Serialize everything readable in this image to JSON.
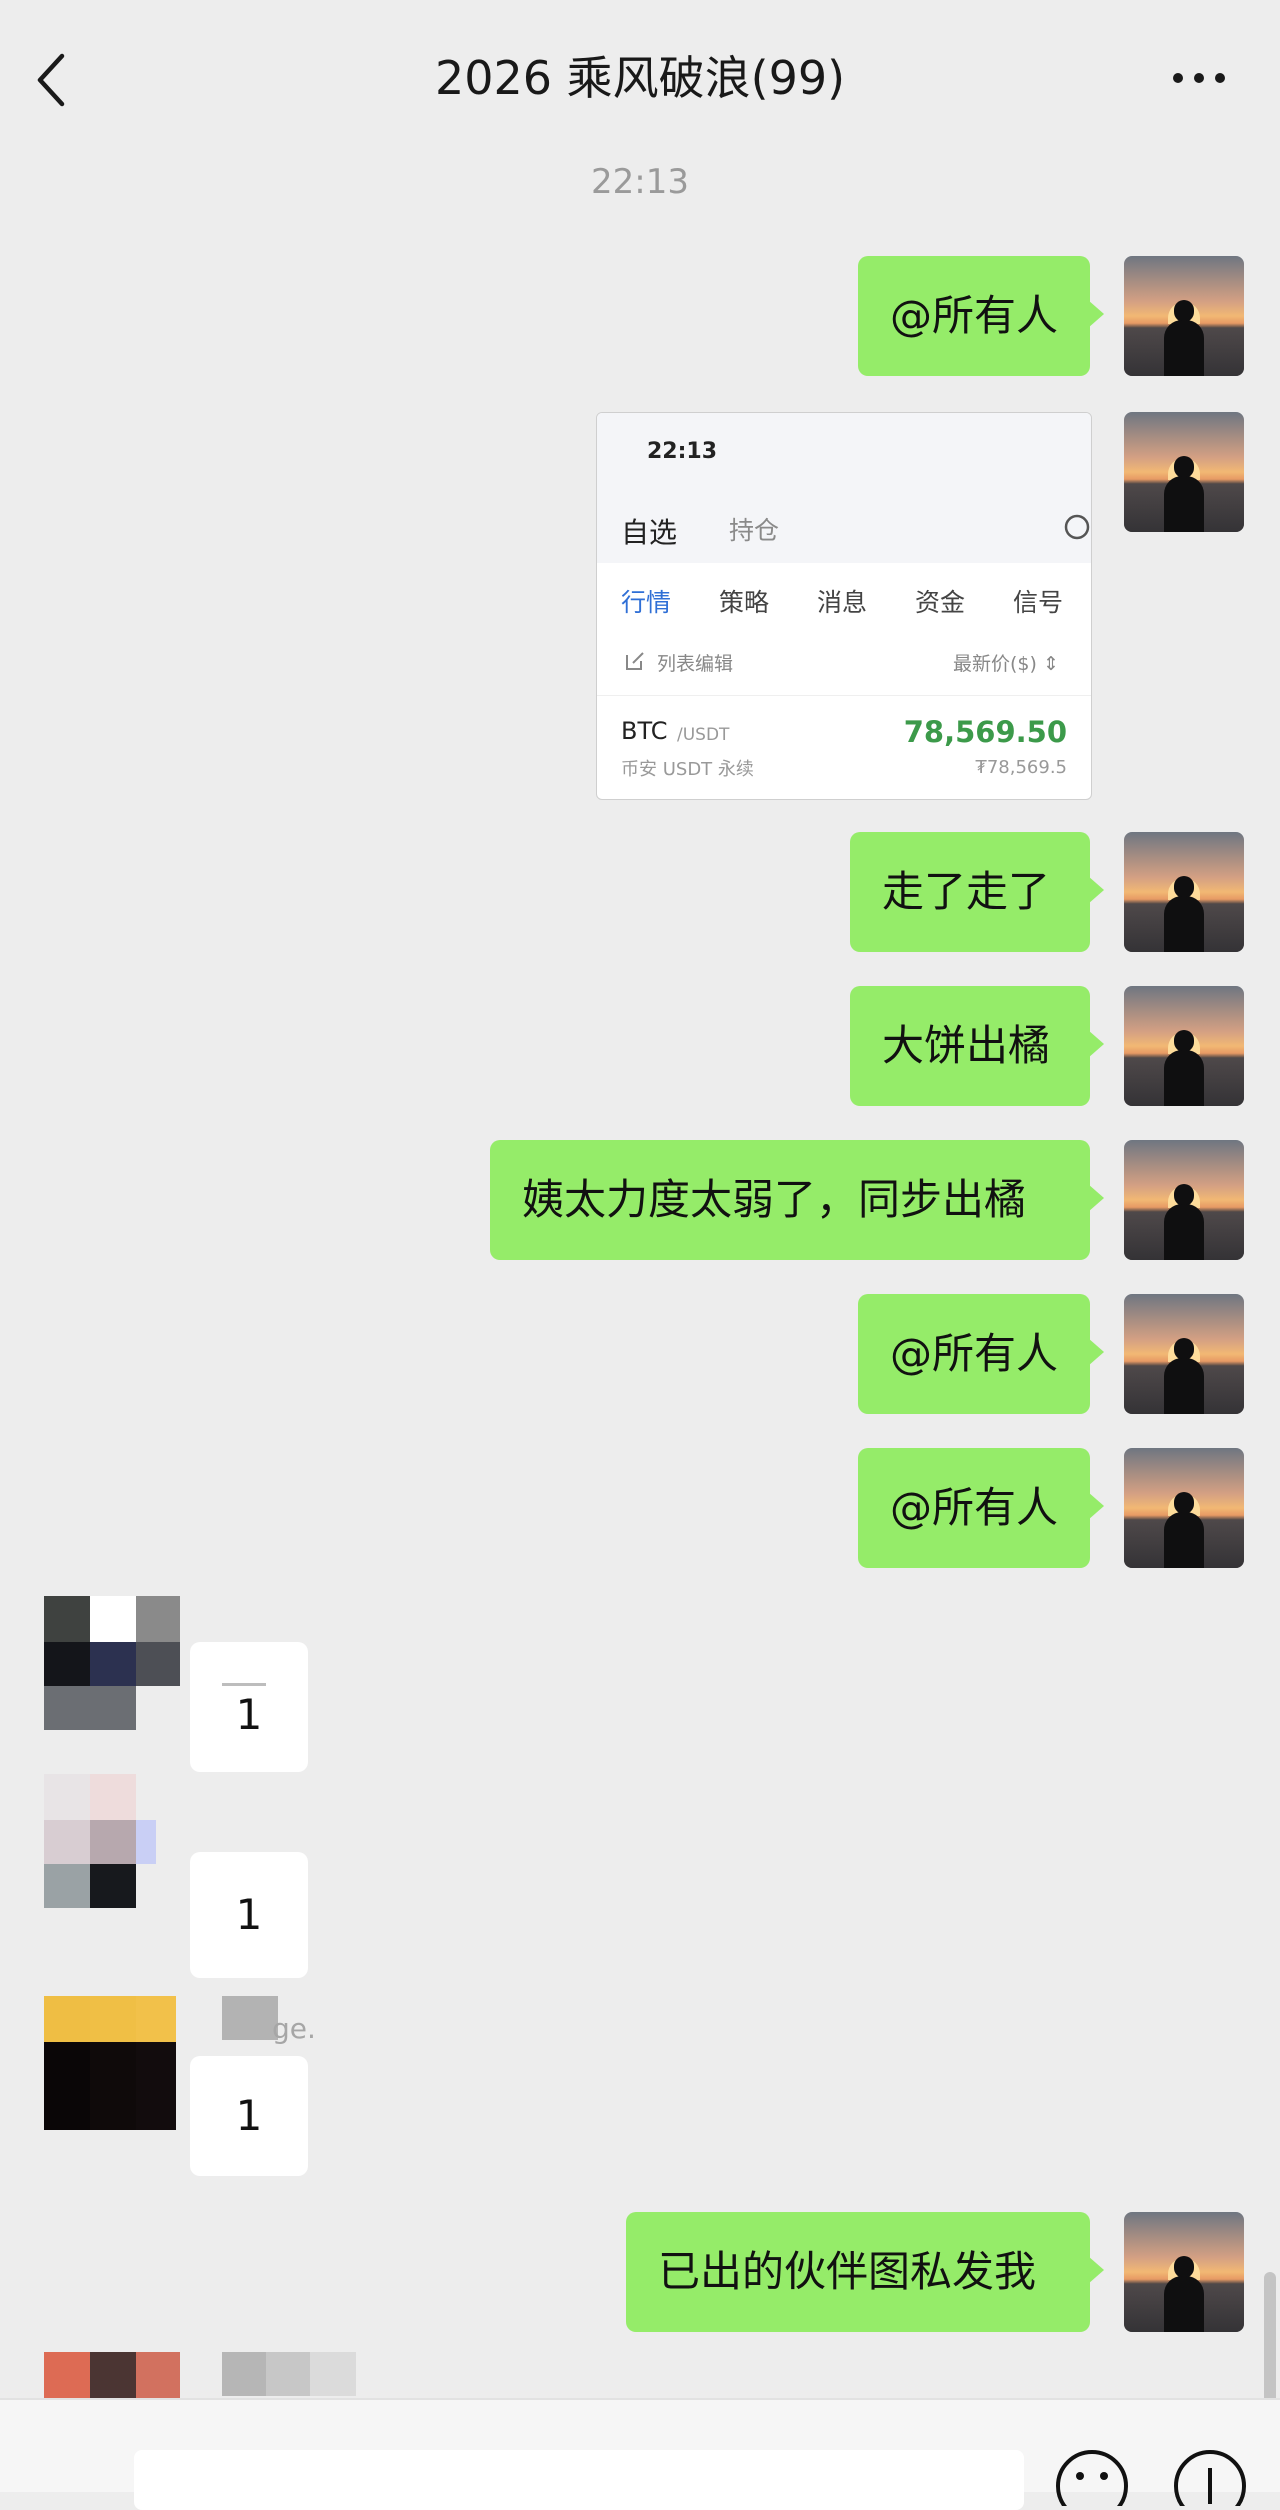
{
  "header": {
    "title": "2026 乘风破浪(99)",
    "back": "back",
    "more": "more"
  },
  "timestamp": "22:13",
  "messages": [
    {
      "side": "right",
      "text": "@所有人"
    },
    {
      "side": "right",
      "type": "image",
      "card": {
        "time": "22:13",
        "tabs": [
          "自选",
          "持仓"
        ],
        "subtabs": [
          "行情",
          "策略",
          "消息",
          "资金",
          "信号"
        ],
        "edit_label": "列表编辑",
        "sort_label": "最新价($) ⇕",
        "symbol": "BTC",
        "pair": "/USDT",
        "exchange": "币安 USDT 永续",
        "price": "78,569.50",
        "price_cny": "₮78,569.5"
      }
    },
    {
      "side": "right",
      "text": "走了走了"
    },
    {
      "side": "right",
      "text": "大饼出橘"
    },
    {
      "side": "right",
      "text": "姨太力度太弱了，同步出橘"
    },
    {
      "side": "right",
      "text": "@所有人"
    },
    {
      "side": "right",
      "text": "@所有人"
    },
    {
      "side": "left",
      "text": "1"
    },
    {
      "side": "left",
      "text": "1"
    },
    {
      "side": "left",
      "name": "ge.",
      "text": "1"
    },
    {
      "side": "right",
      "text": "已出的伙伴图私发我"
    }
  ],
  "colors": {
    "background": "#ededed",
    "bubble_self": "#95ec69",
    "bubble_other": "#ffffff",
    "price_up": "#3c9a4a",
    "tab_active": "#2f6fd6"
  }
}
